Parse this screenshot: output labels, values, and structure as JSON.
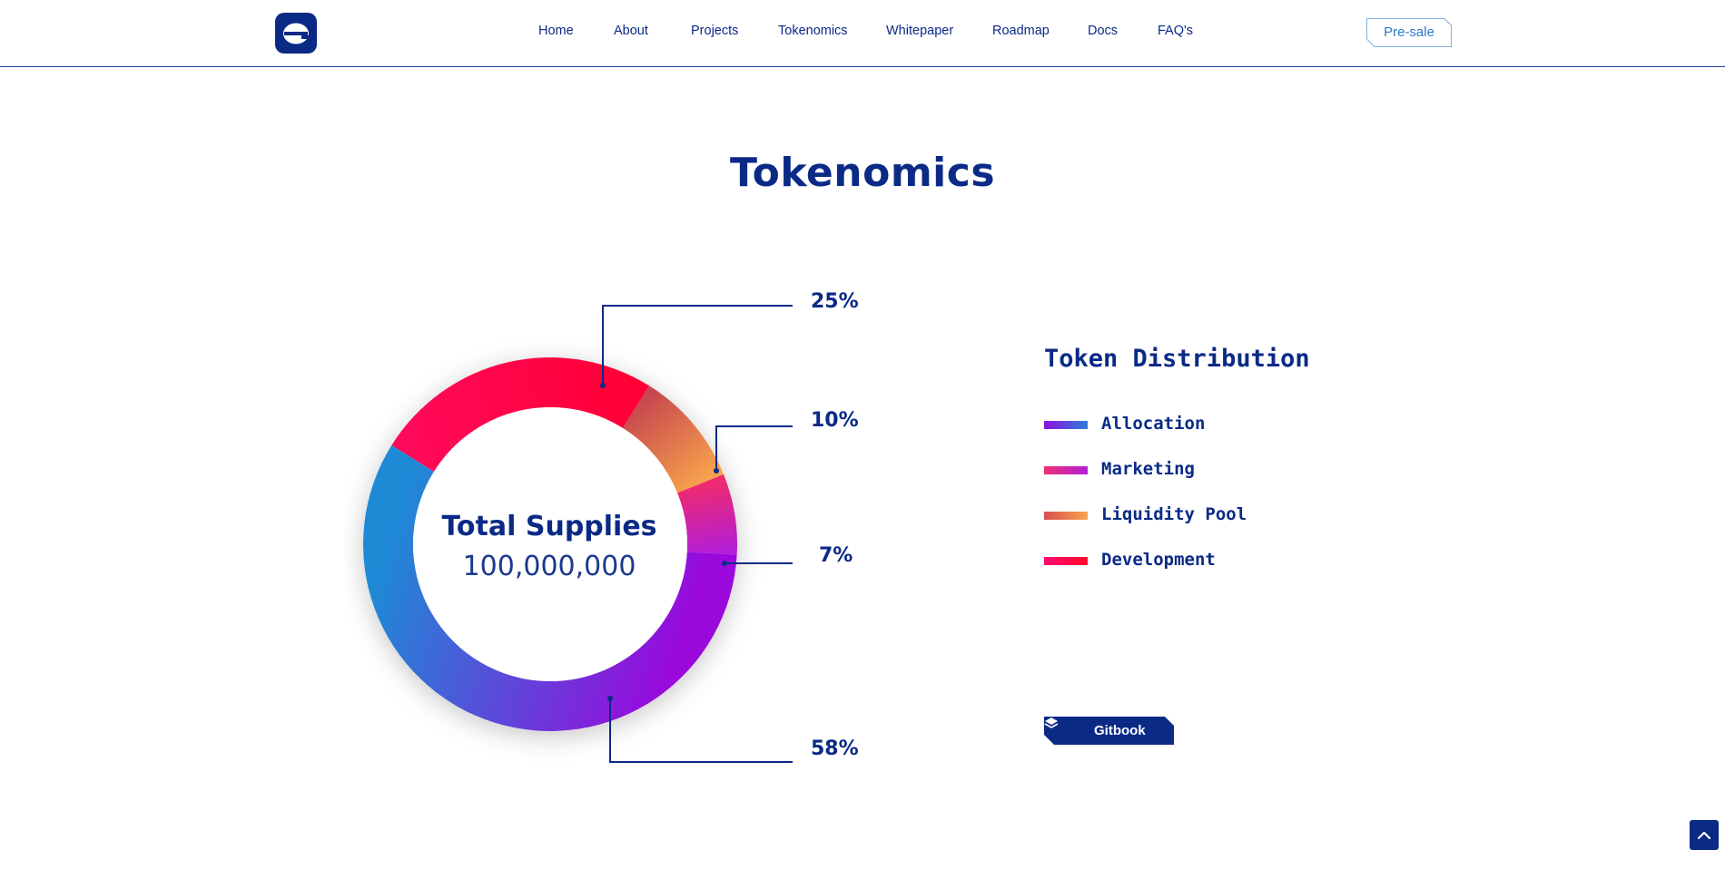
{
  "nav": {
    "items": [
      "Home",
      "About",
      "Projects",
      "Tokenomics",
      "Whitepaper",
      "Roadmap",
      "Docs",
      "FAQ's"
    ],
    "presale_label": "Pre-sale"
  },
  "logo": {
    "icon": "e-letter-logo-icon"
  },
  "section": {
    "title": "Tokenomics"
  },
  "chart_data": {
    "type": "pie",
    "center_label": "Total Supplies",
    "center_value": "100,000,000",
    "slices": [
      {
        "name": "Development",
        "value": 25,
        "label": "25%",
        "colors": [
          "#ff0a5a",
          "#ff0036"
        ]
      },
      {
        "name": "Liquidity Pool",
        "value": 10,
        "label": "10%",
        "colors": [
          "#c8484e",
          "#f7a24d"
        ]
      },
      {
        "name": "Marketing",
        "value": 7,
        "label": "7%",
        "colors": [
          "#f02a6d",
          "#b31ed8"
        ]
      },
      {
        "name": "Allocation",
        "value": 58,
        "label": "58%",
        "colors": [
          "#9a08dc",
          "#1e8ad6"
        ]
      }
    ]
  },
  "legend": {
    "title": "Token Distribution",
    "items": [
      {
        "label": "Allocation",
        "colors": [
          "#8e0fe0",
          "#2a7fd8"
        ]
      },
      {
        "label": "Marketing",
        "colors": [
          "#f0306e",
          "#b21ed8"
        ]
      },
      {
        "label": "Liquidity Pool",
        "colors": [
          "#d8504e",
          "#f7a44d"
        ]
      },
      {
        "label": "Development",
        "colors": [
          "#ff0a6e",
          "#ff0a2e"
        ]
      }
    ]
  },
  "gitbook": {
    "label": "Gitbook",
    "icon": "book-icon"
  },
  "scroll_top": {
    "icon": "chevron-up-icon"
  },
  "colors": {
    "brand": "#0b2a86",
    "accent": "#2a79c9"
  }
}
